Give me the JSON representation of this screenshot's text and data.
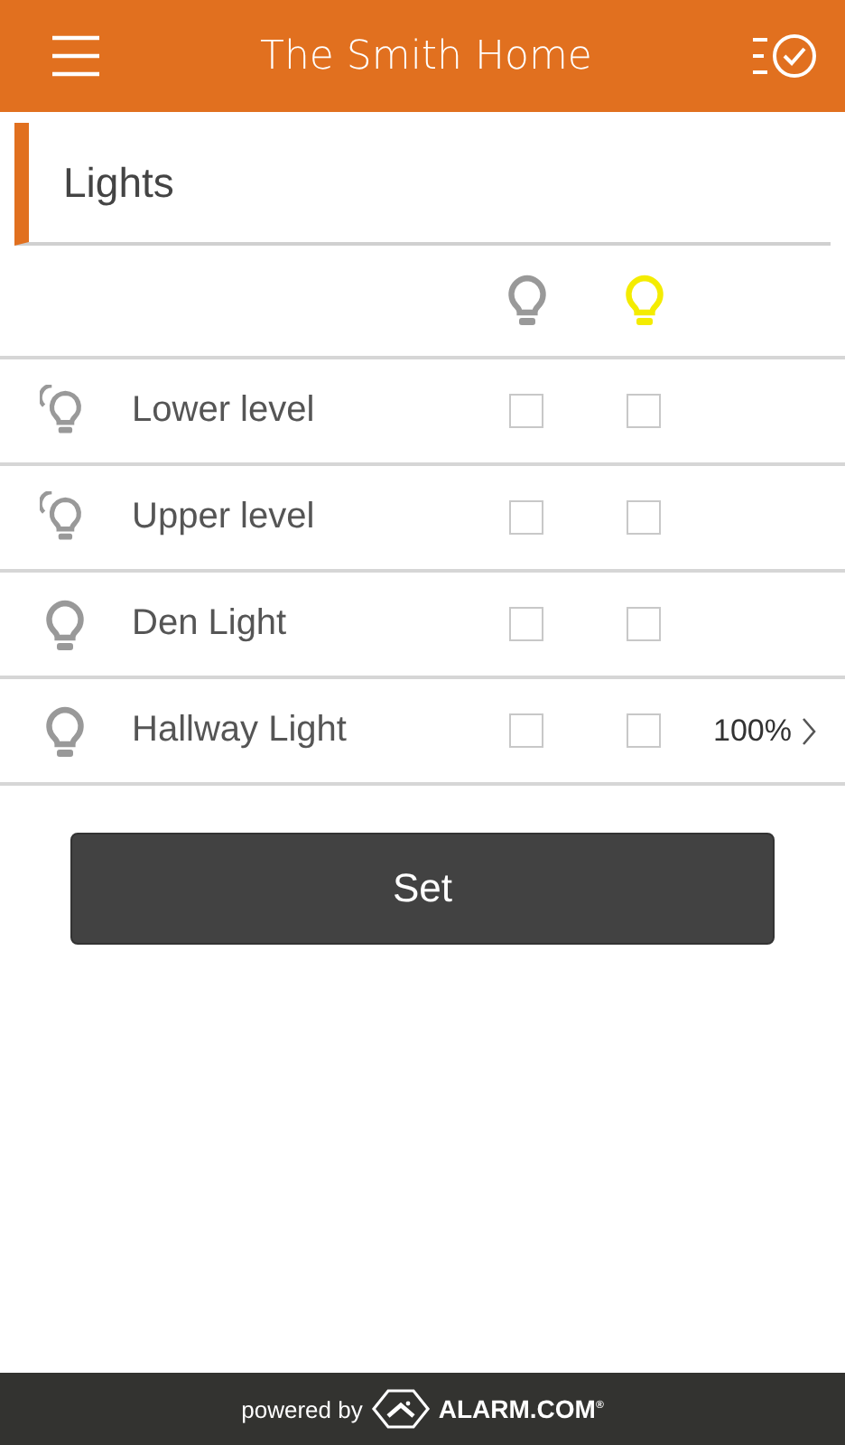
{
  "header": {
    "title": "The Smith Home"
  },
  "section": {
    "title": "Lights"
  },
  "columns": [
    {
      "kind": "off"
    },
    {
      "kind": "on"
    }
  ],
  "rows": [
    {
      "kind": "group",
      "name": "Lower level",
      "off_checked": false,
      "on_checked": false
    },
    {
      "kind": "group",
      "name": "Upper level",
      "off_checked": false,
      "on_checked": false
    },
    {
      "kind": "single",
      "name": "Den Light",
      "off_checked": false,
      "on_checked": false
    },
    {
      "kind": "single",
      "name": "Hallway Light",
      "off_checked": false,
      "on_checked": false,
      "dim_value": "100%"
    }
  ],
  "set_button": "Set",
  "footer": {
    "powered_by": "powered by",
    "brand": "ALARM.COM$^{®}$"
  }
}
